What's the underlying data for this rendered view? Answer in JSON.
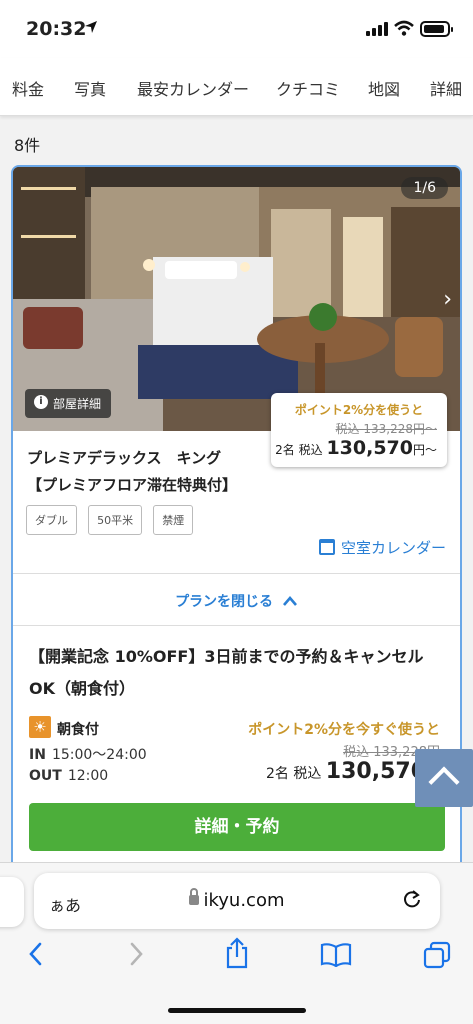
{
  "status_bar": {
    "time": "20:32"
  },
  "tabs": [
    "料金",
    "写真",
    "最安カレンダー",
    "クチコミ",
    "地図",
    "詳細"
  ],
  "result_count": "8件",
  "room": {
    "photo_counter": "1/6",
    "detail_button": "部屋詳細",
    "price_box": {
      "points_text": "ポイント2%分を使うと",
      "old_price": "税込 133,228円〜",
      "people_tax": "2名 税込",
      "price": "130,570",
      "price_suffix": "円〜"
    },
    "name_line1": "プレミアデラックス　キング",
    "name_line2": "【プレミアフロア滞在特典付】",
    "tags": [
      "ダブル",
      "50平米",
      "禁煙"
    ],
    "calendar_link": "空室カレンダー",
    "close_plans": "プランを閉じる"
  },
  "plan": {
    "title": "【開業記念 10%OFF】3日前までの予約＆キャンセルOK（朝食付）",
    "meal_icon": "☀",
    "meal": "朝食付",
    "checkin_label": "IN",
    "checkin_time": "15:00〜24:00",
    "checkout_label": "OUT",
    "checkout_time": "12:00",
    "points_text": "ポイント2%分を今すぐ使うと",
    "old_price": "税込 133,228円",
    "people_tax": "2名 税込",
    "price": "130,570",
    "price_suffix": "円",
    "book_button": "詳細・予約"
  },
  "browser": {
    "aa": "ぁあ",
    "url": "ikyu.com"
  },
  "colors": {
    "link_blue": "#2a7fd4",
    "points_gold": "#c8962b",
    "book_green": "#4cae3a",
    "card_border": "#6aa7e8"
  }
}
